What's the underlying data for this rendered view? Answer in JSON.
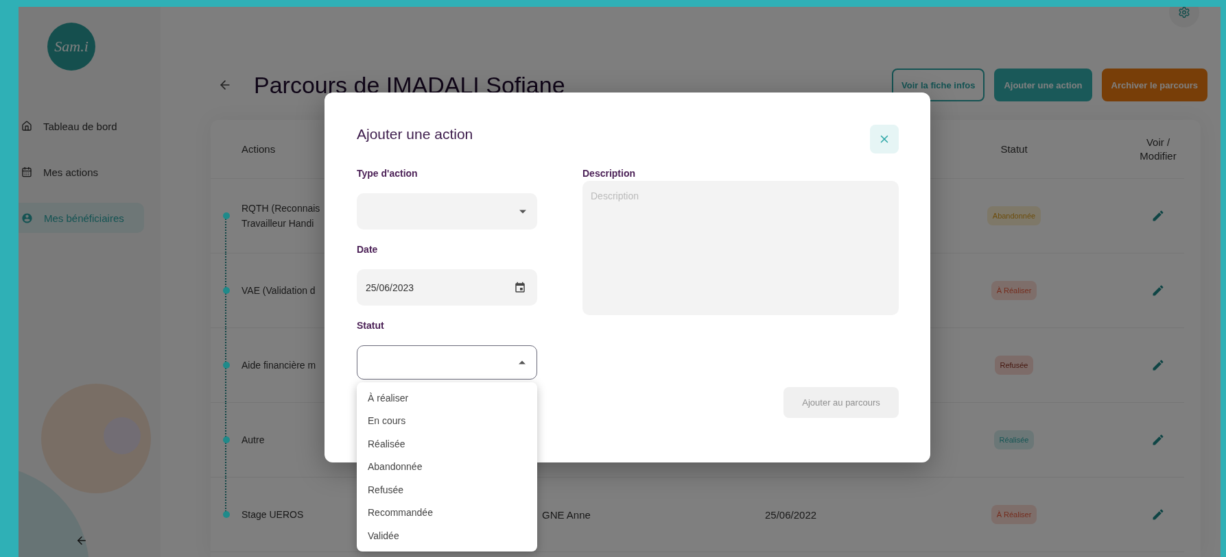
{
  "sidebar": {
    "logo": "Sam.i",
    "items": [
      {
        "label": "Tableau de bord",
        "kind": "home",
        "selected": false
      },
      {
        "label": "Mes actions",
        "kind": "calendar",
        "selected": false
      },
      {
        "label": "Mes bénéficiaires",
        "kind": "person",
        "selected": true
      }
    ]
  },
  "header": {
    "title": "Parcours de IMADALI Sofiane",
    "buttons": [
      {
        "label": "Voir la fiche infos",
        "kind": "outline"
      },
      {
        "label": "Ajouter une action",
        "kind": "primary"
      },
      {
        "label": "Archiver le parcours",
        "kind": "warning"
      }
    ]
  },
  "table": {
    "columns": [
      "Actions",
      "Statut",
      "Voir / Modifier"
    ],
    "rows": [
      {
        "action": [
          "RQTH (Reconnais",
          "Travailleur Handi"
        ],
        "status": {
          "label": "Abandonnée",
          "kind": "abandoned"
        }
      },
      {
        "action": [
          "VAE (Validation d"
        ],
        "status": {
          "label": "À Réaliser",
          "kind": "todo"
        }
      },
      {
        "action": [
          "Aide financière m"
        ],
        "status": {
          "label": "Refusée",
          "kind": "refused"
        }
      },
      {
        "action": [
          "Autre"
        ],
        "status": {
          "label": "Réalisée",
          "kind": "done"
        }
      },
      {
        "action": [
          "Stage UEROS"
        ],
        "column_2": "GNE Anne",
        "column_3": "25/06/2022",
        "status": {
          "label": "À Réaliser",
          "kind": "todo"
        }
      }
    ]
  },
  "modal": {
    "title": "Ajouter une action",
    "fields": [
      {
        "label": "Type d'action",
        "kind": "select",
        "expanded": false
      },
      {
        "label": "Date",
        "kind": "date",
        "value": "25/06/2023"
      },
      {
        "label": "Statut",
        "kind": "select",
        "expanded": true
      }
    ],
    "description": {
      "label": "Description",
      "placeholder": "Description"
    },
    "submit": {
      "label": "Ajouter au parcours",
      "disabled": true
    },
    "dropdown": [
      "À réaliser",
      "En cours",
      "Réalisée",
      "Abandonnée",
      "Refusée",
      "Recommandée",
      "Validée"
    ]
  }
}
